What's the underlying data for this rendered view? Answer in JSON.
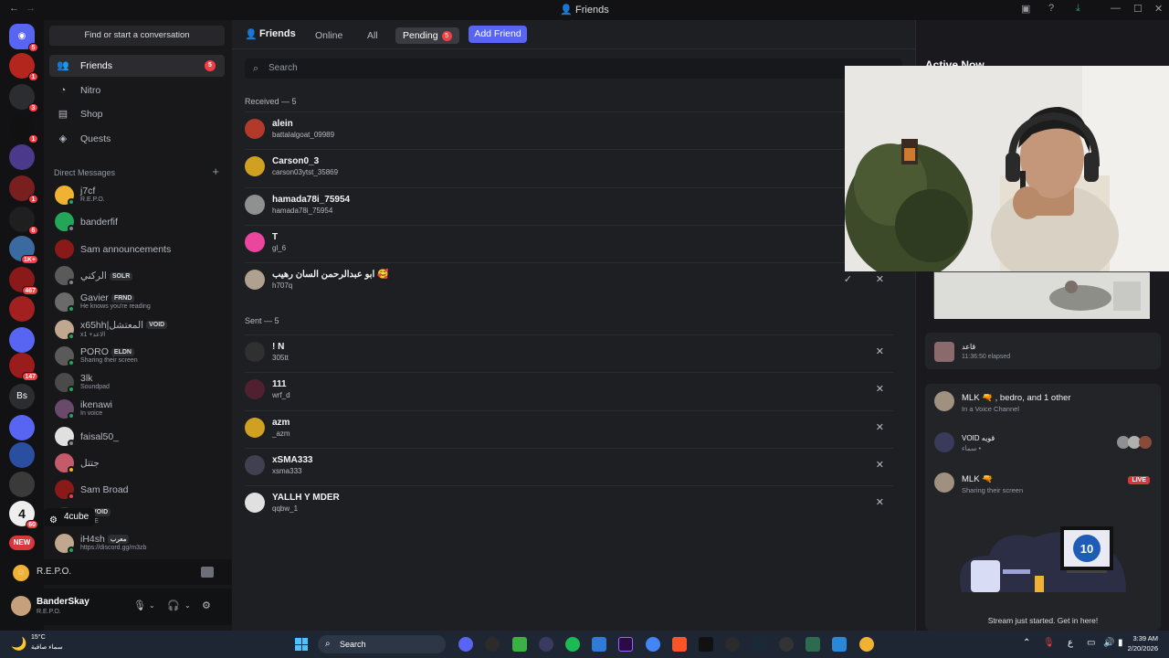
{
  "window": {
    "title": "Friends"
  },
  "servers": [
    {
      "icon": "discord-home-icon",
      "badge": "5",
      "color": "#5865f2"
    },
    {
      "badge": "1",
      "color": "#b3261e"
    },
    {
      "badge": "3",
      "color": "#2b2d31"
    },
    {
      "badge": "1",
      "color": "#111111"
    },
    {
      "badge": "",
      "color": "#4b3a8c"
    },
    {
      "badge": "1",
      "color": "#7a1f1f"
    },
    {
      "badge": "6",
      "color": "#1f1f1f"
    },
    {
      "badge": "1K+",
      "color": "#3b6aa0"
    },
    {
      "badge": "467",
      "color": "#8a1a1a"
    },
    {
      "badge": "",
      "color": "#a32020"
    },
    {
      "badge": "",
      "color": "#5865f2"
    },
    {
      "badge": "147",
      "color": "#9b1c1c"
    },
    {
      "badge": "",
      "color": "#2b2d31",
      "text": "Bs"
    },
    {
      "badge": "",
      "color": "#5865f2"
    },
    {
      "badge": "",
      "color": "#2a4fa0"
    },
    {
      "badge": "",
      "color": "#3a3a3a"
    },
    {
      "badge": "60",
      "color": "#eeeeee",
      "text": "4"
    },
    {
      "badge": "",
      "color": "#da373c",
      "text": "NEW"
    }
  ],
  "sidebar": {
    "find": "Find or start a conversation",
    "nav": [
      {
        "label": "Friends",
        "icon": "friends-icon",
        "badge": "5"
      },
      {
        "label": "Nitro",
        "icon": "nitro-icon"
      },
      {
        "label": "Shop",
        "icon": "shop-icon"
      },
      {
        "label": "Quests",
        "icon": "quests-icon"
      }
    ],
    "dm_header": "Direct Messages",
    "dms": [
      {
        "name": "j7cf",
        "sub": "R.E.P.O.",
        "color": "#f0b232",
        "status": "#23a55a"
      },
      {
        "name": "banderfif",
        "sub": "",
        "color": "#23a55a",
        "status": "#80848e"
      },
      {
        "name": "Sam announcements",
        "sub": "",
        "color": "#8a1a1a",
        "status": ""
      },
      {
        "name": "الركني",
        "tag": "SOLR",
        "sub": "",
        "color": "#5a5a5a",
        "status": "#80848e"
      },
      {
        "name": "Gavier",
        "tag": "FRND",
        "sub": "He knows you're reading",
        "color": "#6a6a6a",
        "status": "#23a55a"
      },
      {
        "name": "x65hh|المعتشل",
        "tag": "VOID",
        "sub": "x1 +الاعد",
        "color": "#c0a890",
        "status": "#23a55a"
      },
      {
        "name": "PORO",
        "tag": "ELDN",
        "sub": "Sharing their screen",
        "color": "#5a5a5a",
        "status": "#23a55a"
      },
      {
        "name": "3lk",
        "sub": "Soundpad",
        "color": "#4a4a4a",
        "status": "#23a55a"
      },
      {
        "name": "ikenawi",
        "sub": "In voice",
        "color": "#6a4a6a",
        "status": "#23a55a"
      },
      {
        "name": "faisal50_",
        "sub": "",
        "color": "#e0e0e0",
        "status": "#80848e"
      },
      {
        "name": "جتتل",
        "sub": "",
        "color": "#c45a6a",
        "status": "#f0b232"
      },
      {
        "name": "Sam Broad",
        "sub": "",
        "color": "#8a1a1a",
        "status": "#f23f43"
      },
      {
        "name": "K",
        "tag": "VOID",
        "sub": "HOPE",
        "color": "#3a3a3a",
        "status": ""
      },
      {
        "name": "iH4sh",
        "tag": "معرب",
        "sub": "https://discord.gg/m3zb",
        "color": "#c0a890",
        "status": "#23a55a"
      }
    ],
    "tooltip": "4cube",
    "activity": "R.E.P.O.",
    "user": {
      "name": "BanderSkay",
      "sub": "R.E.P.O."
    }
  },
  "topnav": {
    "title": "Friends",
    "tabs": [
      "Online",
      "All",
      "Pending"
    ],
    "pending_badge": "5",
    "add": "Add Friend"
  },
  "search_placeholder": "Search",
  "received": {
    "header": "Received — 5",
    "items": [
      {
        "name": "alein",
        "sub": "battalalgoat_09989",
        "color": "#b33a2a",
        "status": "#23a55a"
      },
      {
        "name": "Carson0_3",
        "sub": "carson03ytst_35869",
        "color": "#d0a020",
        "status": ""
      },
      {
        "name": "hamada78i_75954",
        "sub": "hamada78i_75954",
        "color": "#909090",
        "status": ""
      },
      {
        "name": "T",
        "sub": "gl_6",
        "color": "#eb459e",
        "status": ""
      },
      {
        "name": "ابو عبدالرحمن السان رهيب 🥰",
        "sub": "h707q",
        "color": "#b0a090",
        "status": ""
      }
    ]
  },
  "sent": {
    "header": "Sent — 5",
    "items": [
      {
        "name": "! N",
        "sub": "305tt",
        "color": "#303030"
      },
      {
        "name": "111",
        "sub": "wrf_d",
        "color": "#502030"
      },
      {
        "name": "azm",
        "sub": "_azm",
        "color": "#d0a020"
      },
      {
        "name": "xSMA333",
        "sub": "xsma333",
        "color": "#404050"
      },
      {
        "name": "YALLH Y MDER",
        "sub": "qqbw_1",
        "color": "#e0e0e0"
      }
    ]
  },
  "active_now": {
    "title": "Active Now",
    "stream_card": {
      "name": "قاعد",
      "sub": "11:36:50 elapsed"
    },
    "voice_card": {
      "name": "MLK 🔫 , bedro, and 1 other",
      "sub": "In a Voice Channel"
    },
    "void_card": {
      "name": "VOID قويه",
      "sub": "سماء • "
    },
    "live_card": {
      "name": "MLK 🔫",
      "sub": "Sharing their screen",
      "live": "LIVE",
      "cta": "Stream just started. Get in here!"
    }
  },
  "taskbar": {
    "temp": "15°C",
    "weather": "سماء صافية",
    "search": "Search",
    "time": "3:39 AM",
    "date": "2/20/2026",
    "lang": "ع"
  }
}
